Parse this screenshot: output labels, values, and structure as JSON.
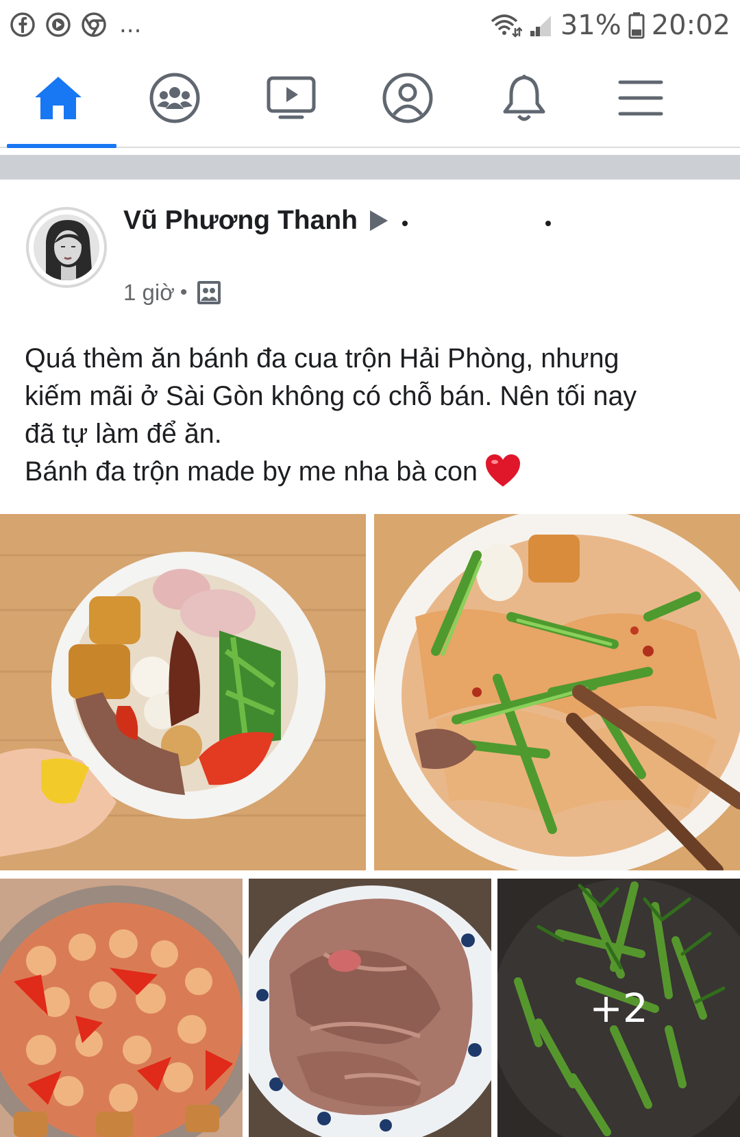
{
  "status_bar": {
    "left_icons": [
      "facebook-icon",
      "messenger-video-icon",
      "chrome-icon"
    ],
    "overflow": "...",
    "battery": "31%",
    "time": "20:02",
    "right_icons": [
      "wifi-icon",
      "signal-icon",
      "battery-icon"
    ]
  },
  "nav": {
    "tabs": [
      {
        "name": "home",
        "icon": "home-icon",
        "active": true
      },
      {
        "name": "groups",
        "icon": "groups-icon",
        "active": false
      },
      {
        "name": "watch",
        "icon": "video-icon",
        "active": false
      },
      {
        "name": "profile",
        "icon": "profile-icon",
        "active": false
      },
      {
        "name": "notifications",
        "icon": "bell-icon",
        "active": false
      },
      {
        "name": "menu",
        "icon": "menu-icon",
        "active": false
      }
    ],
    "accent_color": "#1877f2"
  },
  "post": {
    "author": "Vũ Phương Thanh",
    "time": "1 giờ",
    "separator": "•",
    "audience_icon": "group-audience-icon",
    "lines": [
      "Quá thèm ăn bánh đa cua trộn Hải Phòng, nhưng",
      "kiếm mãi ở Sài Gòn không có chỗ bán. Nên tối nay",
      "đã tự làm để ăn.",
      "Bánh đa trộn made by me nha bà con"
    ],
    "more_photos": "+2"
  }
}
